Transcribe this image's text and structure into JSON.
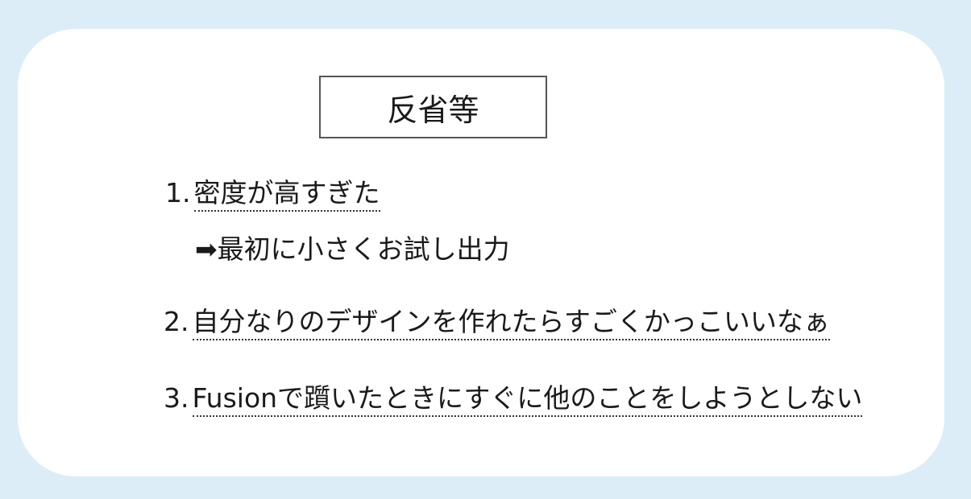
{
  "title": "反省等",
  "items": [
    {
      "number": "1.",
      "text": "密度が高すぎた"
    },
    {
      "arrow": "➡",
      "text": "最初に小さくお試し出力"
    },
    {
      "number": "2.",
      "text": "自分なりのデザインを作れたらすごくかっこいいなぁ"
    },
    {
      "number": "3.",
      "text": "Fusionで躓いたときにすぐに他のことをしようとしない"
    }
  ],
  "colors": {
    "background": "#dcedf7",
    "card": "#ffffff",
    "text": "#1a1a1a"
  }
}
